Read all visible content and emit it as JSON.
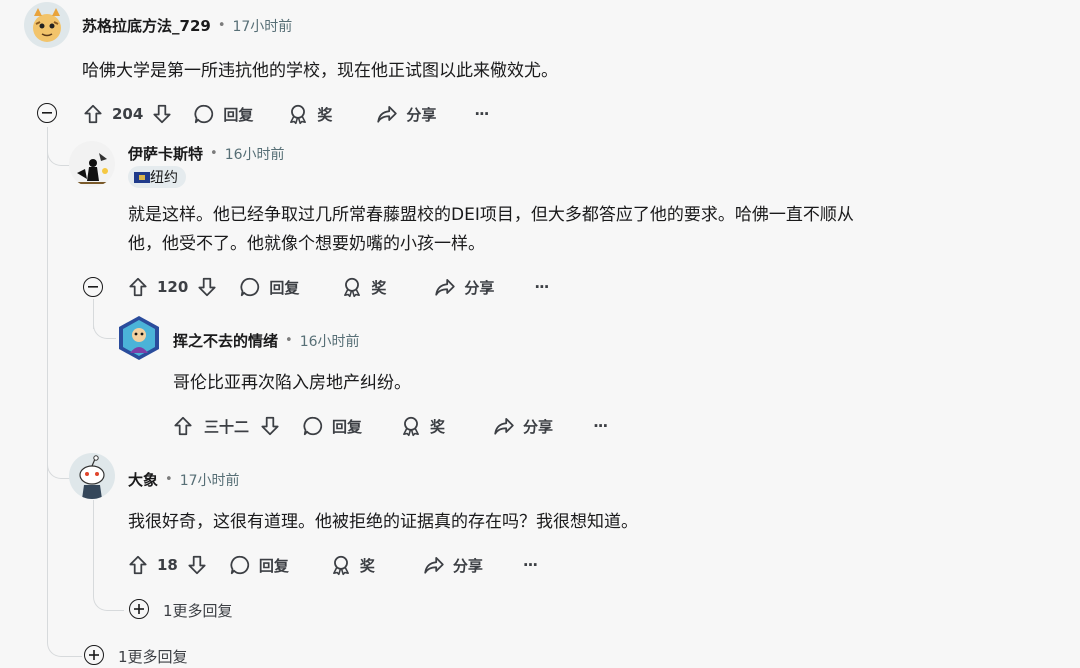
{
  "comments": [
    {
      "author": "苏格拉底方法_729",
      "time": "17小时前",
      "body": "哈佛大学是第一所违抗他的学校，现在他正试图以此来儆效尤。",
      "score": "204",
      "reply_label": "回复",
      "award_label": "奖",
      "share_label": "分享",
      "more_label": "···"
    },
    {
      "author": "伊萨卡斯特",
      "time": "16小时前",
      "flair": "纽约",
      "body_line1": "就是这样。他已经争取过几所常春藤盟校的DEI项目，但大多都答应了他的要求。哈佛一直不顺从",
      "body_line2": "他，他受不了。他就像个想要奶嘴的小孩一样。",
      "score": "120",
      "reply_label": "回复",
      "award_label": "奖",
      "share_label": "分享",
      "more_label": "···"
    },
    {
      "author": "挥之不去的情绪",
      "time": "16小时前",
      "body": "哥伦比亚再次陷入房地产纠纷。",
      "score": "三十二",
      "reply_label": "回复",
      "award_label": "奖",
      "share_label": "分享",
      "more_label": "···"
    },
    {
      "author": "大象",
      "time": "17小时前",
      "body": "我很好奇，这很有道理。他被拒绝的证据真的存在吗？我很想知道。",
      "score": "18",
      "reply_label": "回复",
      "award_label": "奖",
      "share_label": "分享",
      "more_label": "···"
    }
  ],
  "more_replies_1": "1更多回复",
  "more_replies_2": "1更多回复",
  "icons": {
    "upvote": "upvote-icon",
    "downvote": "downvote-icon",
    "reply": "comment-bubble-icon",
    "award": "award-icon",
    "share": "share-icon",
    "collapse": "minus-circle-icon",
    "expand": "plus-circle-icon"
  }
}
